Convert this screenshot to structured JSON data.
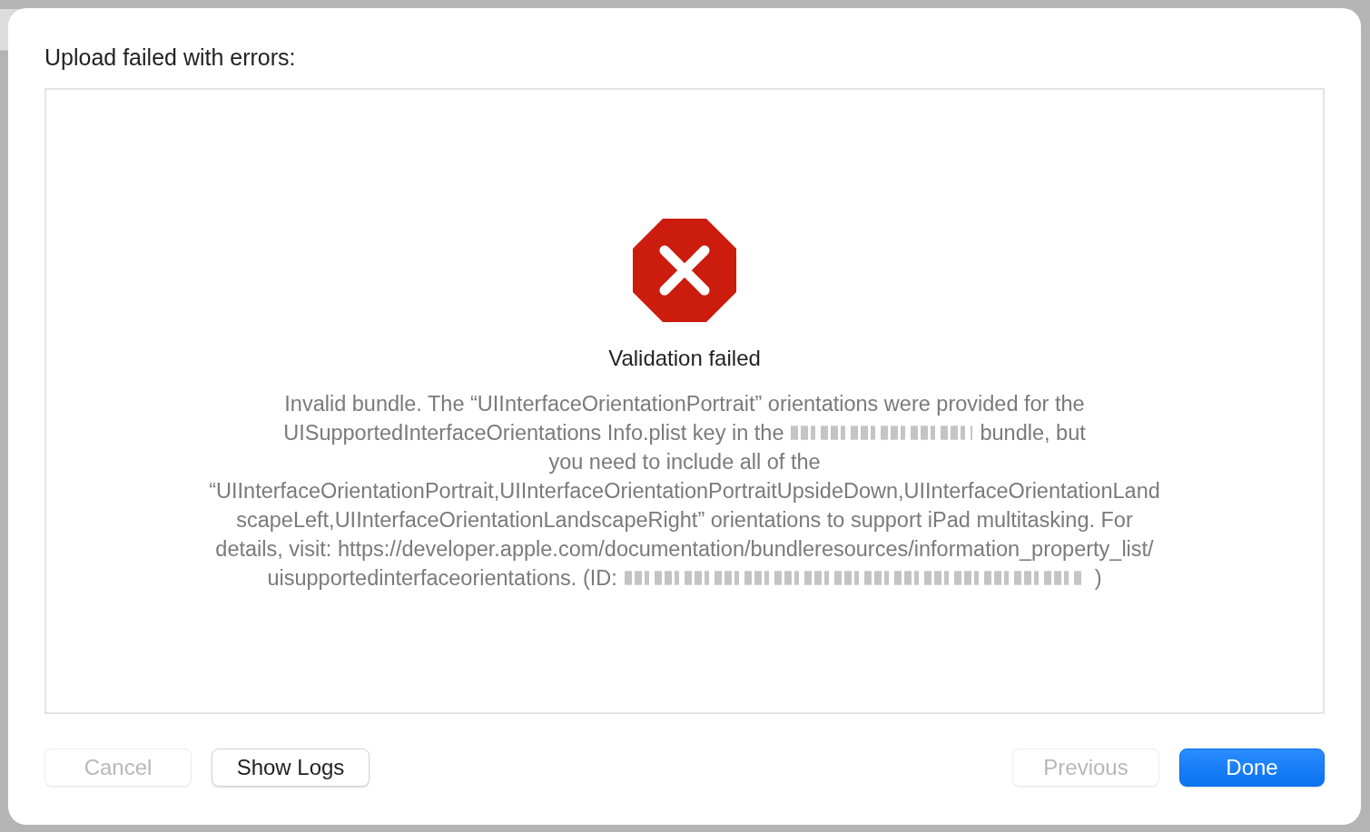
{
  "dialog": {
    "title": "Upload failed with errors:",
    "result": {
      "heading": "Validation failed",
      "message_lines": [
        [
          {
            "kind": "text",
            "text": "Invalid bundle. The “UIInterfaceOrientationPortrait” orientations were provided for the"
          }
        ],
        [
          {
            "kind": "text",
            "text": "UISupportedInterfaceOrientations Info.plist key in the"
          },
          {
            "kind": "redacted"
          },
          {
            "kind": "text",
            "text": "bundle, but"
          }
        ],
        [
          {
            "kind": "text",
            "text": "you need to include all of the"
          }
        ],
        [
          {
            "kind": "text",
            "text": "“UIInterfaceOrientationPortrait,UIInterfaceOrientationPortraitUpsideDown,UIInterfaceOrientationLand"
          }
        ],
        [
          {
            "kind": "text",
            "text": "scapeLeft,UIInterfaceOrientationLandscapeRight” orientations to support iPad multitasking. For"
          }
        ],
        [
          {
            "kind": "text",
            "text": "details, visit: https://developer.apple.com/documentation/bundleresources/information_property_list/"
          }
        ],
        [
          {
            "kind": "text",
            "text": "uisupportedinterfaceorientations. (ID:"
          },
          {
            "kind": "redacted"
          },
          {
            "kind": "text",
            "text": ")"
          }
        ]
      ]
    },
    "buttons_left": [
      {
        "label": "Cancel",
        "disabled": true,
        "default": false
      },
      {
        "label": "Show Logs",
        "disabled": false,
        "default": false
      }
    ],
    "buttons_right": [
      {
        "label": "Previous",
        "disabled": true,
        "default": false
      },
      {
        "label": "Done",
        "disabled": false,
        "default": true
      }
    ]
  }
}
